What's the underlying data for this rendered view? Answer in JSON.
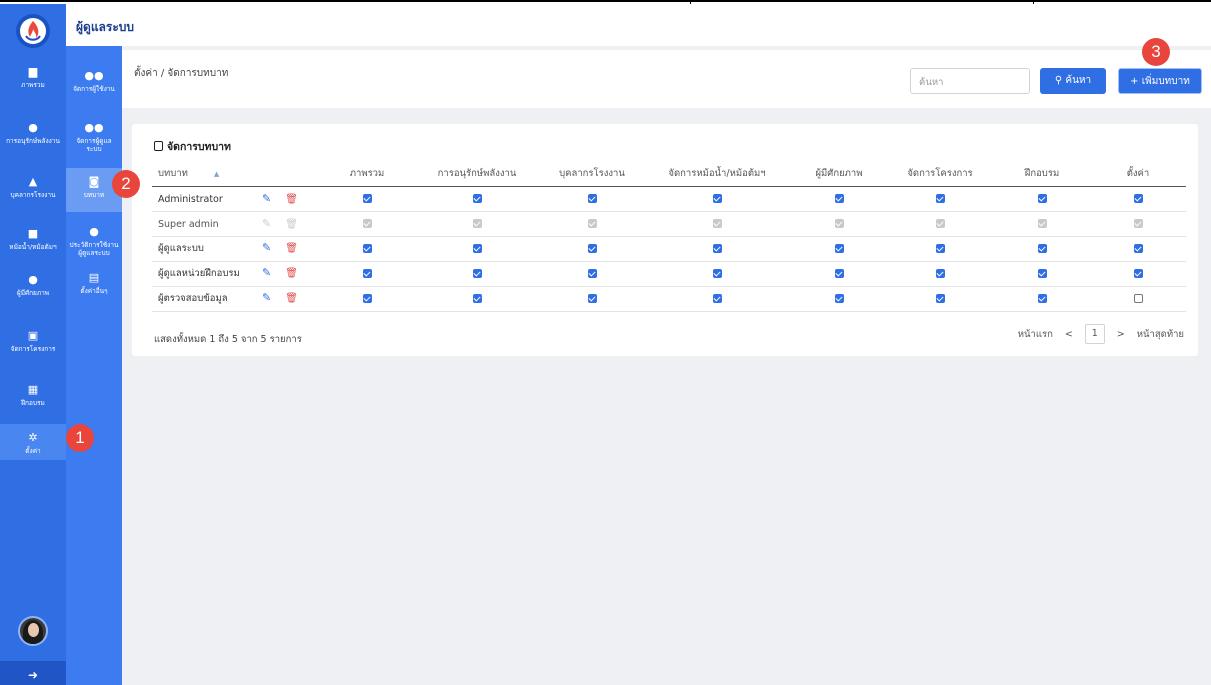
{
  "app": {
    "title": "ผู้ดูแลระบบ"
  },
  "sidebar_main": {
    "items": [
      {
        "label": "ภาพรวม",
        "icon": "monitor-icon"
      },
      {
        "label": "การอนุรักษ์พลังงาน",
        "icon": "bulb-icon"
      },
      {
        "label": "บุคลากรโรงงาน",
        "icon": "factory-icon"
      },
      {
        "label": "หม้อน้ำ/หม้อต้มฯ",
        "icon": "boiler-icon"
      },
      {
        "label": "ผู้มีศักยภาพ",
        "icon": "person-icon"
      },
      {
        "label": "จัดการโครงการ",
        "icon": "clipboard-icon"
      },
      {
        "label": "ฝึกอบรม",
        "icon": "training-icon"
      },
      {
        "label": "ตั้งค่า",
        "icon": "gear-icon"
      }
    ]
  },
  "sidebar_sub": {
    "items": [
      {
        "label": "จัดการผู้ใช้งาน",
        "icon": "users-icon"
      },
      {
        "label": "จัดการผู้ดูแลระบบ",
        "icon": "admin-icon"
      },
      {
        "label": "บทบาท",
        "icon": "role-icon"
      },
      {
        "label": "ประวัติการใช้งานผู้ดูแลระบบ",
        "icon": "history-icon"
      },
      {
        "label": "ตั้งค่าอื่นๆ",
        "icon": "file-plus-icon"
      }
    ]
  },
  "breadcrumb": "ตั้งค่า / จัดการบทบาท",
  "search": {
    "placeholder": "ค้นหา",
    "button": "ค้นหา"
  },
  "add_button": "+ เพิ่มบทบาท",
  "card": {
    "title": "จัดการบทบาท",
    "columns": [
      "บทบาท",
      "ภาพรวม",
      "การอนุรักษ์พลังงาน",
      "บุคลากรโรงงาน",
      "จัดการหม้อน้ำ/หม้อต้มฯ",
      "ผู้มีศักยภาพ",
      "จัดการโครงการ",
      "ฝึกอบรม",
      "ตั้งค่า"
    ],
    "rows": [
      {
        "role": "Administrator",
        "editable": true,
        "perms": [
          true,
          true,
          true,
          true,
          true,
          true,
          true,
          true
        ]
      },
      {
        "role": "Super admin",
        "editable": false,
        "perms": [
          true,
          true,
          true,
          true,
          true,
          true,
          true,
          true
        ]
      },
      {
        "role": "ผู้ดูแลระบบ",
        "editable": true,
        "perms": [
          true,
          true,
          true,
          true,
          true,
          true,
          true,
          true
        ]
      },
      {
        "role": "ผู้ดูแลหน่วยฝึกอบรม",
        "editable": true,
        "perms": [
          true,
          true,
          true,
          true,
          true,
          true,
          true,
          true
        ]
      },
      {
        "role": "ผู้ตรวจสอบข้อมูล",
        "editable": true,
        "perms": [
          true,
          true,
          true,
          true,
          true,
          true,
          true,
          false
        ]
      }
    ],
    "summary": "แสดงทั้งหมด 1 ถึง 5 จาก 5 รายการ"
  },
  "pagination": {
    "first": "หน้าแรก",
    "prev": "<",
    "page": "1",
    "next": ">",
    "last": "หน้าสุดท้าย"
  },
  "annotations": [
    "1",
    "2",
    "3"
  ],
  "colors": {
    "primary": "#2f6fe3",
    "sidebar": "#2f6fe3",
    "danger": "#e05050",
    "badge": "#e8453c"
  }
}
